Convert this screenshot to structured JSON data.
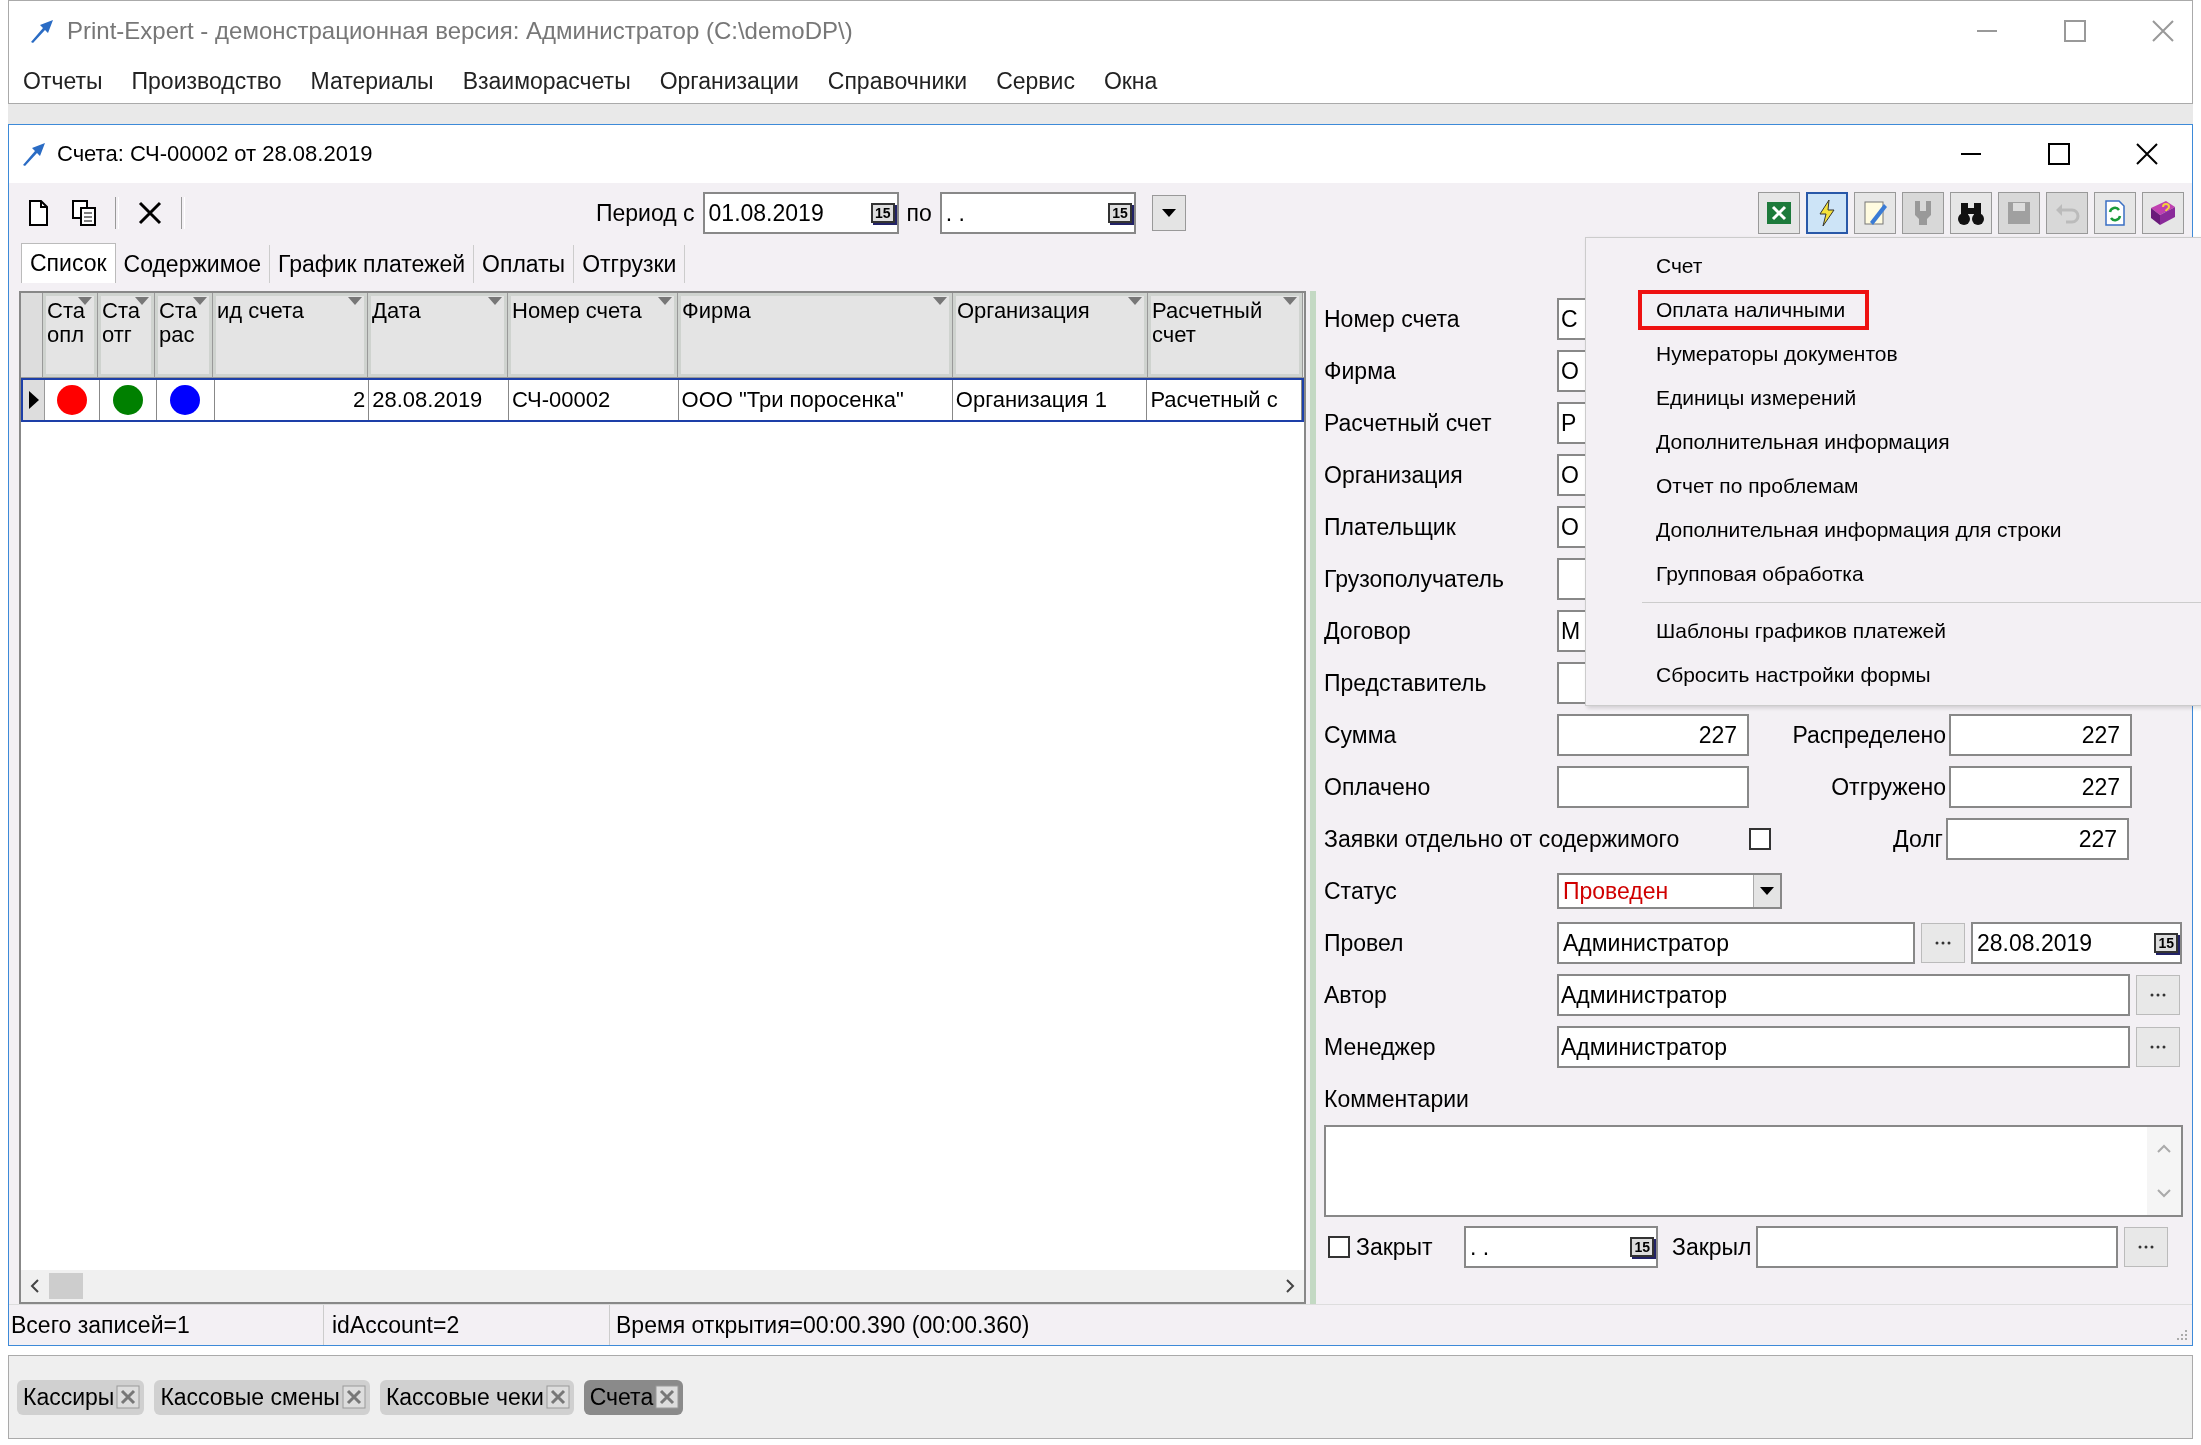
{
  "app": {
    "title": "Print-Expert - демонстрационная версия: Администратор (C:\\demoDP\\)",
    "menu": [
      "Отчеты",
      "Производство",
      "Материалы",
      "Взаиморасчеты",
      "Организации",
      "Справочники",
      "Сервис",
      "Окна"
    ]
  },
  "window": {
    "title": "Счета: СЧ-00002 от 28.08.2019"
  },
  "toolbar": {
    "left_tools": [
      {
        "kind": "new"
      },
      {
        "kind": "copy"
      },
      {
        "kind": "delete"
      }
    ],
    "period_label": "Период с",
    "from": {
      "value": "01.08.2019",
      "button": "15"
    },
    "to_label": "по",
    "to": {
      "value": ".  .",
      "button": "15"
    },
    "right_tools": [
      {
        "kind": "excel",
        "pressed": false,
        "disabled": false
      },
      {
        "kind": "lightning",
        "pressed": true,
        "disabled": false
      },
      {
        "kind": "edit",
        "pressed": false,
        "disabled": false
      },
      {
        "kind": "plug",
        "pressed": false,
        "disabled": true
      },
      {
        "kind": "binoculars",
        "pressed": false,
        "disabled": false
      },
      {
        "kind": "save",
        "pressed": false,
        "disabled": true
      },
      {
        "kind": "undo",
        "pressed": false,
        "disabled": true
      },
      {
        "kind": "refresh",
        "pressed": false,
        "disabled": false
      },
      {
        "kind": "help",
        "pressed": false,
        "disabled": false
      }
    ]
  },
  "tabs": [
    {
      "label": "Список",
      "selected": true
    },
    {
      "label": "Содержимое",
      "selected": false
    },
    {
      "label": "График платежей",
      "selected": false
    },
    {
      "label": "Оплаты",
      "selected": false
    },
    {
      "label": "Отгрузки",
      "selected": false
    }
  ],
  "grid": {
    "status_columns": [
      {
        "label": "Ста опл"
      },
      {
        "label": "Ста отг"
      },
      {
        "label": "Ста рас"
      }
    ],
    "columns": [
      {
        "label": "ид счета"
      },
      {
        "label": "Дата"
      },
      {
        "label": "Номер счета"
      },
      {
        "label": "Фирма"
      },
      {
        "label": "Организация"
      },
      {
        "label": "Расчетный счет"
      }
    ],
    "rows": [
      {
        "selected": true,
        "statuses": [
          {
            "color": "#ff0000"
          },
          {
            "color": "#008000"
          },
          {
            "color": "#0000ff"
          }
        ],
        "cells": [
          "2",
          "28.08.2019",
          "СЧ-00002",
          "ООО \"Три поросенка\"",
          "Организация 1",
          "Расчетный с"
        ]
      }
    ]
  },
  "form": {
    "fields": [
      {
        "label": "Номер счета",
        "value": "С"
      },
      {
        "label": "Фирма",
        "value": "О"
      },
      {
        "label": "Расчетный счет",
        "value": "Р"
      },
      {
        "label": "Организация",
        "value": "О"
      },
      {
        "label": "Плательщик",
        "value": "О"
      },
      {
        "label": "Грузополучатель"
      },
      {
        "label": "Договор",
        "value": "М"
      },
      {
        "label": "Представитель"
      }
    ],
    "sums": [
      {
        "label": "Сумма",
        "value": "227",
        "right_label": "Распределено",
        "right_value": "227"
      },
      {
        "label": "Оплачено",
        "right_label": "Отгружено",
        "right_value": "227"
      }
    ],
    "separate_requests": {
      "label": "Заявки отдельно от содержимого",
      "checked": false,
      "right_label": "Долг",
      "right_value": "227"
    },
    "status": {
      "label": "Статус",
      "value": "Проведен"
    },
    "posted": {
      "label": "Провел",
      "value": "Администратор",
      "date": "28.08.2019",
      "button": "15"
    },
    "people": [
      {
        "label": "Автор",
        "value": "Администратор"
      },
      {
        "label": "Менеджер",
        "value": "Администратор"
      }
    ],
    "comments": {
      "label": "Комментарии"
    },
    "closed": {
      "label": "Закрыт",
      "checked": false,
      "date": ".  .",
      "button": "15",
      "by_label": "Закрыл"
    }
  },
  "context_menu": {
    "items": [
      {
        "kind": "item",
        "label": "Счет",
        "outlined": false
      },
      {
        "kind": "item",
        "label": "Оплата наличными",
        "outlined": true
      },
      {
        "kind": "item",
        "label": "Нумераторы документов",
        "outlined": false
      },
      {
        "kind": "item",
        "label": "Единицы измерений",
        "outlined": false
      },
      {
        "kind": "item",
        "label": "Дополнительная информация",
        "outlined": false
      },
      {
        "kind": "item",
        "label": "Отчет по проблемам",
        "outlined": false
      },
      {
        "kind": "item",
        "label": "Дополнительная информация для строки",
        "outlined": false
      },
      {
        "kind": "item",
        "label": "Групповая обработка",
        "outlined": false
      },
      {
        "kind": "separator"
      },
      {
        "kind": "item",
        "label": "Шаблоны графиков платежей",
        "outlined": false
      },
      {
        "kind": "item",
        "label": "Сбросить настройки формы",
        "outlined": false
      }
    ]
  },
  "status_bar": [
    "Всего записей=1",
    "idAccount=2",
    "Время открытия=00:00.390 (00:00.360)"
  ],
  "taskbar": [
    {
      "label": "Кассиры",
      "selected": false
    },
    {
      "label": "Кассовые смены",
      "selected": false
    },
    {
      "label": "Кассовые чеки",
      "selected": false
    },
    {
      "label": "Счета",
      "selected": true
    }
  ]
}
